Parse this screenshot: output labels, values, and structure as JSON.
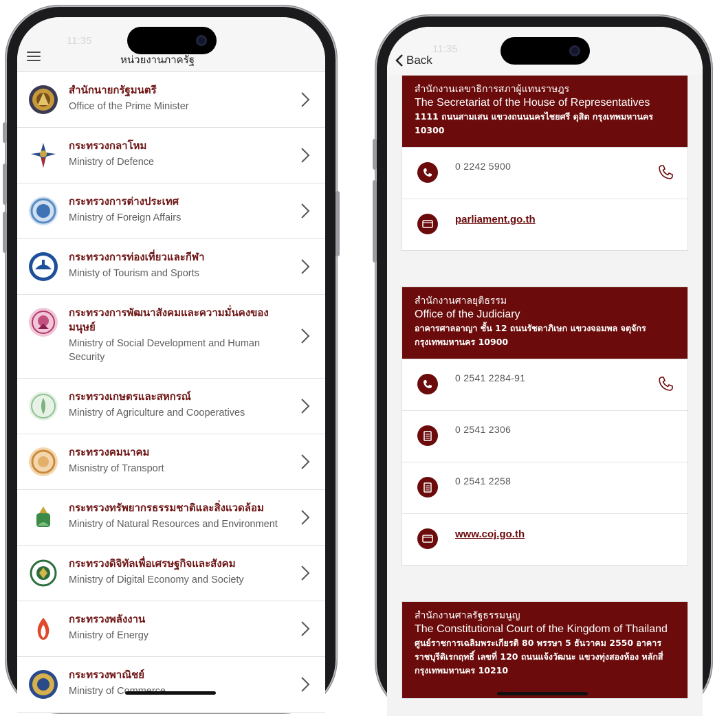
{
  "left_screen": {
    "status_time": "11:35",
    "nav_title": "หน่วยงานภาครัฐ",
    "rows": [
      {
        "th": "สำนักนายกรัฐมนตรี",
        "en": "Office of the Prime Minister",
        "logo": "prime-minister-seal"
      },
      {
        "th": "กระทรวงกลาโหม",
        "en": "Ministry of Defence",
        "logo": "defence-emblem"
      },
      {
        "th": "กระทรวงการต่างประเทศ",
        "en": "Ministry of Foreign Affairs",
        "logo": "foreign-affairs-seal"
      },
      {
        "th": "กระทรวงการท่องเที่ยวและกีฬา",
        "en": "Ministy of Tourism and Sports",
        "logo": "tourism-sports-seal"
      },
      {
        "th": "กระทรวงการพัฒนาสังคมและความมั่นคงของมนุษย์",
        "en": "Ministry of Social Development and Human Security",
        "logo": "social-development-seal"
      },
      {
        "th": "กระทรวงเกษตรและสหกรณ์",
        "en": "Ministry of Agriculture and Cooperatives",
        "logo": "agriculture-seal"
      },
      {
        "th": "กระทรวงคมนาคม",
        "en": "Misnistry of Transport",
        "logo": "transport-seal"
      },
      {
        "th": "กระทรวงทรัพยากรธรรมชาติและสิ่งแวดล้อม",
        "en": "Ministry of Natural Resources and Environment",
        "logo": "natural-resources-seal"
      },
      {
        "th": "กระทรวงดิจิทัลเพื่อเศรษฐกิจและสังคม",
        "en": "Ministry of Digital Economy and Society",
        "logo": "digital-economy-seal"
      },
      {
        "th": "กระทรวงพลังงาน",
        "en": "Ministry of Energy",
        "logo": "energy-flame-emblem"
      },
      {
        "th": "กระทรวงพาณิชย์",
        "en": "Ministry of Commerce",
        "logo": "commerce-seal"
      }
    ]
  },
  "right_screen": {
    "status_time": "11:35",
    "back_label": "Back",
    "cards": [
      {
        "th": "สำนักงานเลขาธิการสภาผู้แทนราษฎร",
        "en": "The Secretariat of the House of Representatives",
        "address": "1111 ถนนสามเสน แขวงถนนนครไชยศรี ดุสิต กรุงเทพมหานคร 10300",
        "contacts": [
          {
            "type": "phone",
            "icon": "phone-icon",
            "value": "0 2242 5900",
            "callable": true
          },
          {
            "type": "web",
            "icon": "web-icon",
            "value": "parliament.go.th"
          }
        ]
      },
      {
        "th": "สำนักงานศาลยุติธรรม",
        "en": "Office of the Judiciary",
        "address": "อาคารศาลอาญา ชั้น 12 ถนนรัชดาภิเษก แขวงจอมพล จตุจักร กรุงเทพมหานคร 10900",
        "contacts": [
          {
            "type": "phone",
            "icon": "phone-icon",
            "value": "0 2541 2284-91",
            "callable": true
          },
          {
            "type": "fax",
            "icon": "fax-icon",
            "value": "0 2541 2306"
          },
          {
            "type": "fax",
            "icon": "fax-icon",
            "value": "0 2541 2258"
          },
          {
            "type": "web",
            "icon": "web-icon",
            "value": "www.coj.go.th"
          }
        ]
      },
      {
        "th": "สำนักงานศาลรัฐธรรมนูญ",
        "en": "The Constitutional Court of the Kingdom of Thailand",
        "address": "ศูนย์ราชการเฉลิมพระเกียรติ 80 พรรษา 5 ธันวาคม 2550 อาคารราชบุรีดิเรกฤทธิ์ เลขที่ 120 ถนนแจ้งวัฒนะ แขวงทุ่งสองห้อง หลักสี่ กรุงเทพมหานคร 10210",
        "contacts": []
      }
    ]
  },
  "colors": {
    "accent": "#6b0b0b",
    "title_text": "#6e1515",
    "subtitle_text": "#5e5e5e",
    "nav_bg": "#f6f6f6"
  }
}
